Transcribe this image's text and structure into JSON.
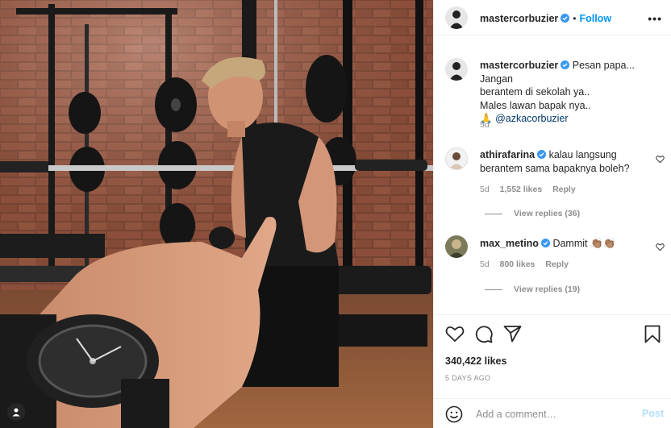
{
  "post": {
    "author": "mastercorbuzier",
    "follow_label": "Follow",
    "more_label": "•••",
    "caption": {
      "line1": "Pesan papa... Jangan",
      "line2": "berantem di sekolah ya..",
      "line3": "Males lawan bapak nya..",
      "mention": "@azkacorbuzier",
      "emoji": "🙏",
      "time": "5d"
    }
  },
  "comments": [
    {
      "user": "athirafarina",
      "text_line1": "kalau langsung",
      "text_line2": "berantem sama bapaknya boleh?",
      "time": "5d",
      "likes": "1,552 likes",
      "reply_label": "Reply",
      "view_replies": "View replies (36)"
    },
    {
      "user": "max_metino",
      "text": "Dammit",
      "emoji": "👏🏽👏🏽",
      "time": "5d",
      "likes": "800 likes",
      "reply_label": "Reply",
      "view_replies": "View replies (19)"
    }
  ],
  "footer": {
    "likes_count": "340,422 likes",
    "posted_ago": "5 DAYS AGO",
    "comment_placeholder": "Add a comment…",
    "post_label": "Post"
  },
  "colors": {
    "accent": "#0095f6",
    "verified": "#3897f0",
    "muted": "#8e8e8e",
    "text": "#262626",
    "border": "#efefef"
  },
  "icons": [
    "heart-icon",
    "comment-icon",
    "share-icon",
    "bookmark-icon",
    "verified-badge-icon",
    "emoji-icon",
    "user-tag-icon",
    "more-icon"
  ]
}
